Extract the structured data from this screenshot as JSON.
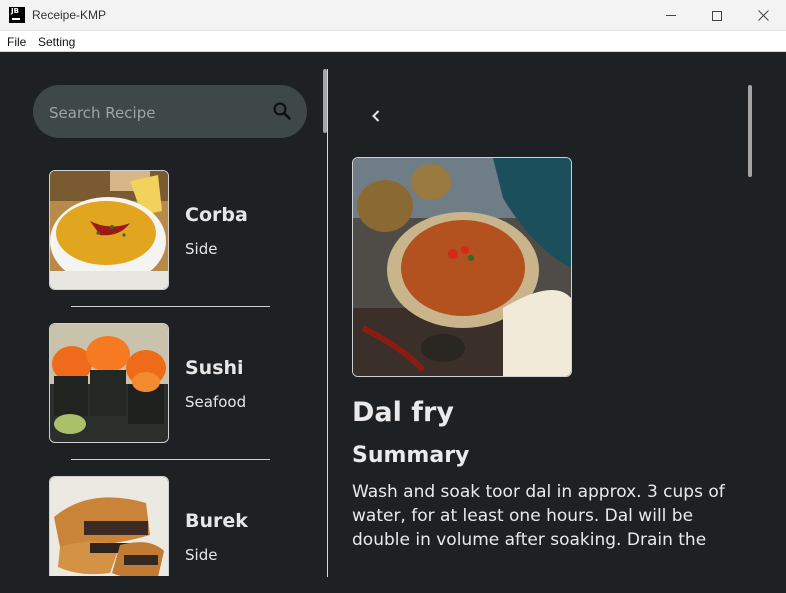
{
  "window": {
    "title": "Receipe-KMP",
    "icon_text": "JB",
    "controls": [
      "minimize-icon",
      "maximize-icon",
      "close-icon"
    ]
  },
  "menu": {
    "file": "File",
    "setting": "Setting"
  },
  "search": {
    "placeholder": "Search Recipe",
    "icon": "search-icon"
  },
  "recipes": [
    {
      "name": "Corba",
      "category": "Side"
    },
    {
      "name": "Sushi",
      "category": "Seafood"
    },
    {
      "name": "Burek",
      "category": "Side"
    }
  ],
  "detail": {
    "back_icon": "chevron-left-icon",
    "title": "Dal fry",
    "summary_heading": "Summary",
    "summary_text": "Wash and soak toor dal in approx. 3 cups of water, for at least one hours. Dal will be double in volume after soaking. Drain the"
  },
  "colors": {
    "background": "#1e2124",
    "search_bg": "#3e4846",
    "text": "#e6e6e6",
    "titlebar": "#f3f3f3"
  }
}
